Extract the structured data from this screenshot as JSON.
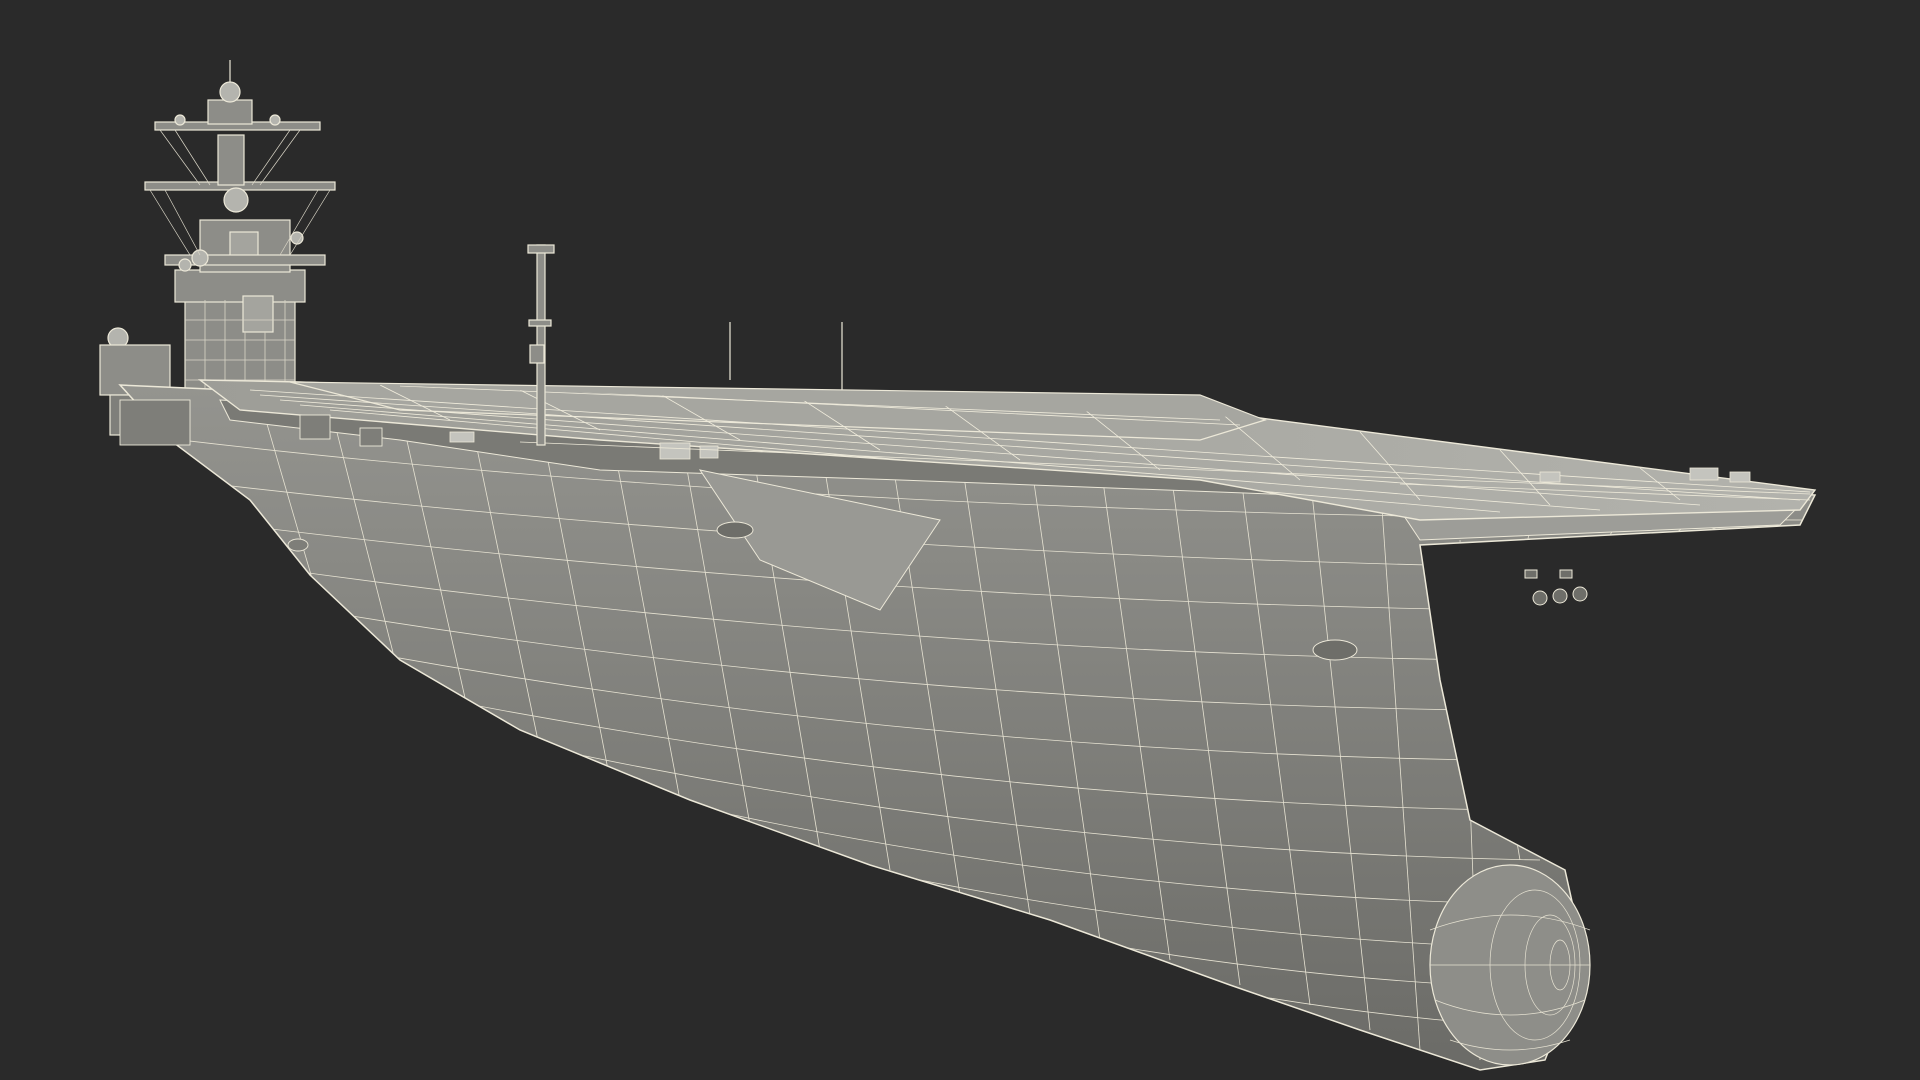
{
  "scene": {
    "background_color": "#2a2a2a",
    "hull_fill": "#8a8a86",
    "hull_shadow": "#6f6f6b",
    "deck_fill": "#a9a9a3",
    "wire_color": "#ece8d8",
    "wire_color_dim": "#cfcabb"
  }
}
